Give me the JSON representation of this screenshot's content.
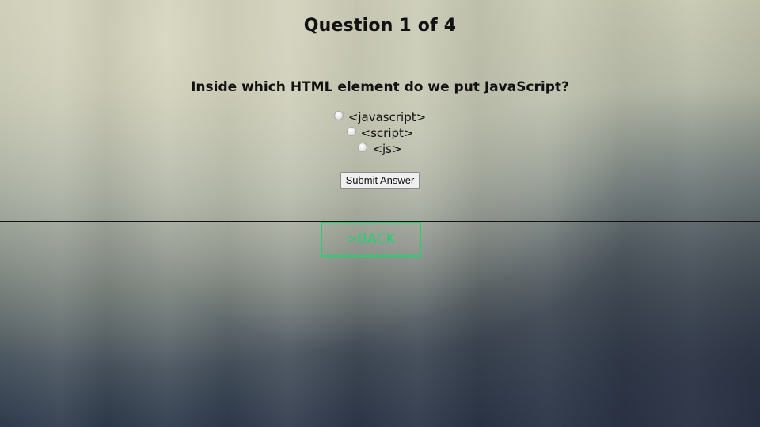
{
  "header": {
    "title": "Question 1 of 4"
  },
  "quiz": {
    "question": "Inside which HTML element do we put JavaScript?",
    "options": [
      {
        "label": "<javascript>"
      },
      {
        "label": "<script>"
      },
      {
        "label": "<js>"
      }
    ],
    "submit_label": "Submit Answer"
  },
  "nav": {
    "back_label": ">BACK"
  },
  "colors": {
    "accent": "#22d26e",
    "divider": "#111111"
  }
}
